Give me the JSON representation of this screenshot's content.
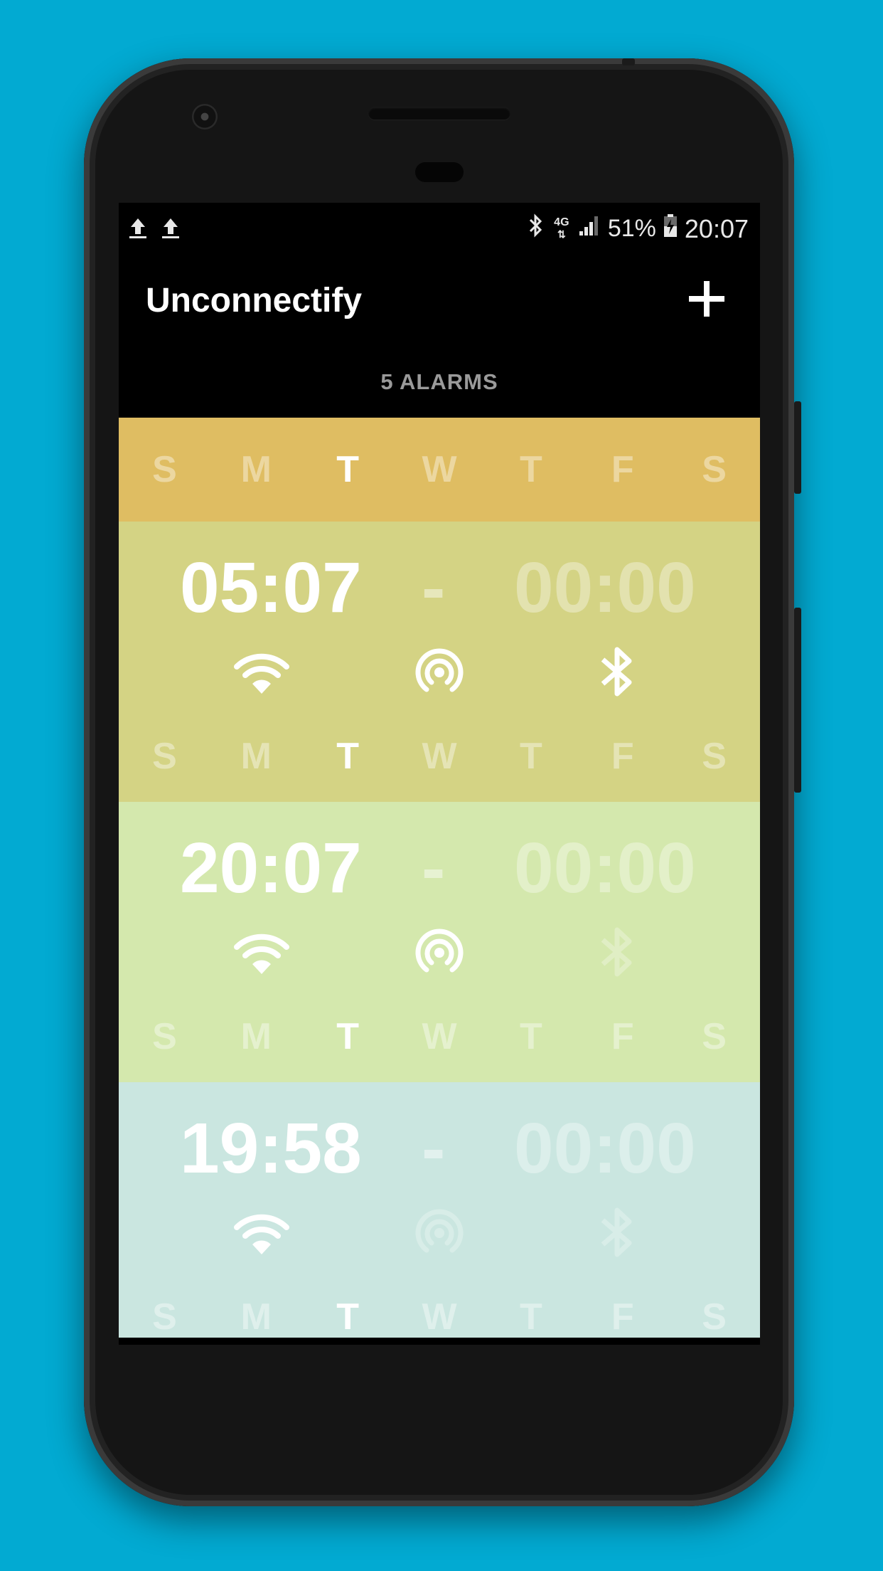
{
  "status_bar": {
    "signal_text": "4G",
    "battery": "51%",
    "time": "20:07"
  },
  "app_bar": {
    "title": "Unconnectify",
    "add_icon": "plus-icon"
  },
  "tab": {
    "label": "5 ALARMS"
  },
  "header_days": {
    "color": "#dfbd62",
    "days": [
      {
        "letter": "S",
        "active": false
      },
      {
        "letter": "M",
        "active": false
      },
      {
        "letter": "T",
        "active": true
      },
      {
        "letter": "W",
        "active": false
      },
      {
        "letter": "T",
        "active": false
      },
      {
        "letter": "F",
        "active": false
      },
      {
        "letter": "S",
        "active": false
      }
    ]
  },
  "alarms": [
    {
      "color": "#d4d384",
      "start": "05:07",
      "separator": "-",
      "end": "00:00",
      "wifi": true,
      "hotspot": true,
      "bluetooth": true,
      "days": [
        {
          "letter": "S",
          "active": false
        },
        {
          "letter": "M",
          "active": false
        },
        {
          "letter": "T",
          "active": true
        },
        {
          "letter": "W",
          "active": false
        },
        {
          "letter": "T",
          "active": false
        },
        {
          "letter": "F",
          "active": false
        },
        {
          "letter": "S",
          "active": false
        }
      ]
    },
    {
      "color": "#d4e8ad",
      "start": "20:07",
      "separator": "-",
      "end": "00:00",
      "wifi": true,
      "hotspot": true,
      "bluetooth": false,
      "days": [
        {
          "letter": "S",
          "active": false
        },
        {
          "letter": "M",
          "active": false
        },
        {
          "letter": "T",
          "active": true
        },
        {
          "letter": "W",
          "active": false
        },
        {
          "letter": "T",
          "active": false
        },
        {
          "letter": "F",
          "active": false
        },
        {
          "letter": "S",
          "active": false
        }
      ]
    },
    {
      "color": "#cae6e0",
      "start": "19:58",
      "separator": "-",
      "end": "00:00",
      "wifi": true,
      "hotspot": false,
      "bluetooth": false,
      "days": [
        {
          "letter": "S",
          "active": false
        },
        {
          "letter": "M",
          "active": false
        },
        {
          "letter": "T",
          "active": true
        },
        {
          "letter": "W",
          "active": false
        },
        {
          "letter": "T",
          "active": false
        },
        {
          "letter": "F",
          "active": false
        },
        {
          "letter": "S",
          "active": false
        }
      ]
    }
  ]
}
